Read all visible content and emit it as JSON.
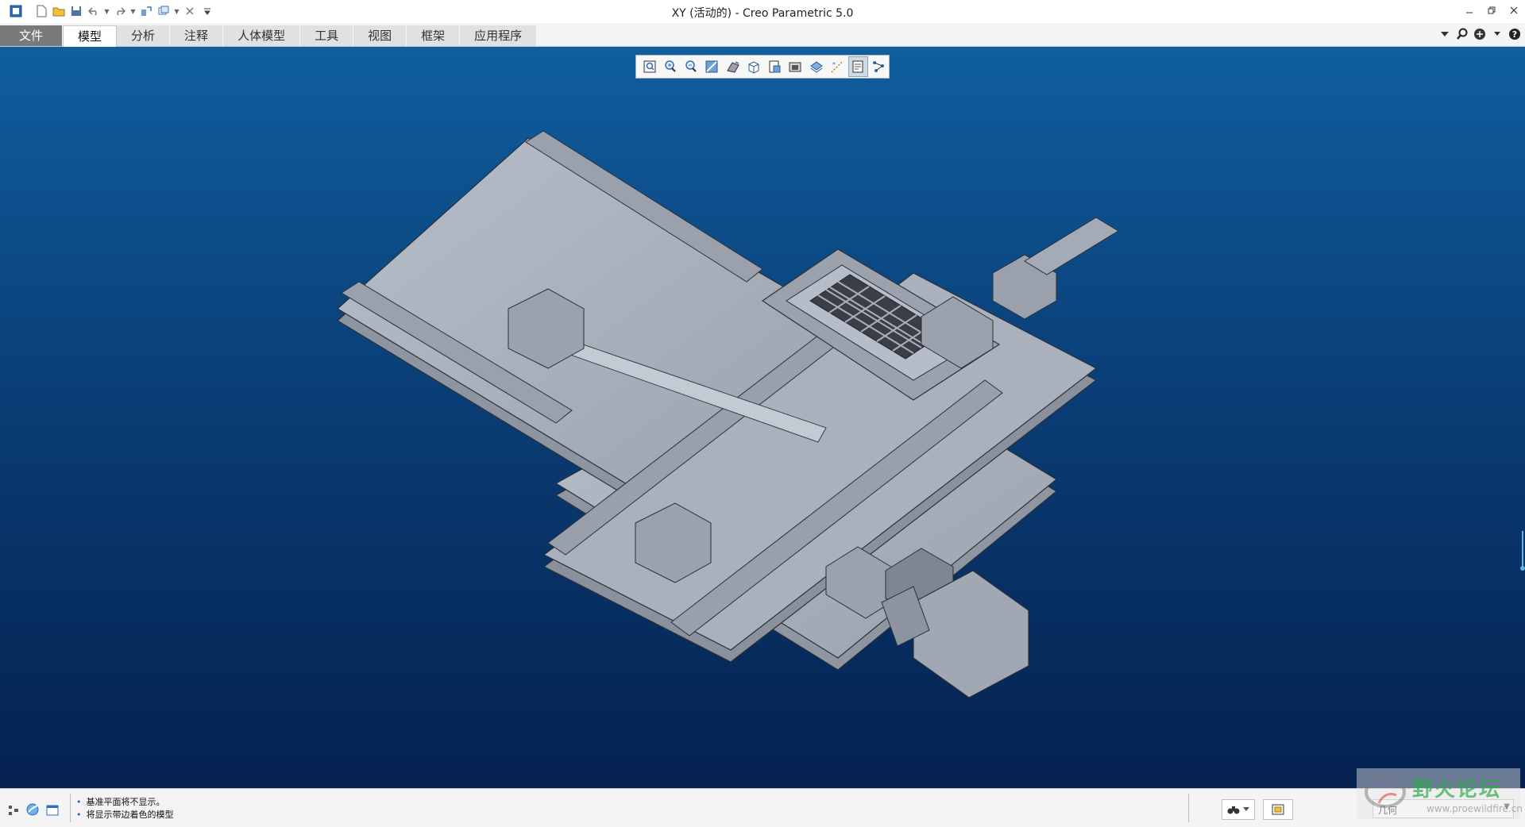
{
  "window": {
    "title": "XY (活动的) - Creo Parametric 5.0"
  },
  "quick_access": [
    "new-icon",
    "open-icon",
    "save-icon",
    "undo-icon",
    "redo-icon",
    "regenerate-icon",
    "windows-icon",
    "close-window-icon",
    "customize-icon"
  ],
  "ribbon": {
    "tabs": [
      "文件",
      "模型",
      "分析",
      "注释",
      "人体模型",
      "工具",
      "视图",
      "框架",
      "应用程序"
    ],
    "active_tab": "模型"
  },
  "graphics_toolbar": [
    "refit-icon",
    "zoom-in-icon",
    "zoom-out-icon",
    "repaint-icon",
    "perspective-icon",
    "saved-orientations-icon",
    "view-manager-icon",
    "display-style-icon",
    "datum-display-icon",
    "annotation-display-icon",
    "spin-center-icon",
    "appearance-icon"
  ],
  "status": {
    "messages": [
      "基准平面将不显示。",
      "将显示带边着色的模型"
    ],
    "filter": {
      "value": "几何"
    }
  },
  "watermark": {
    "text": "野火论坛",
    "url": "www.proewildfire.cn"
  },
  "colors": {
    "viewport_top": "#0f5e9f",
    "viewport_bottom": "#052150",
    "model_face": "#a9b0bc",
    "file_tab": "#7a7a7a"
  }
}
